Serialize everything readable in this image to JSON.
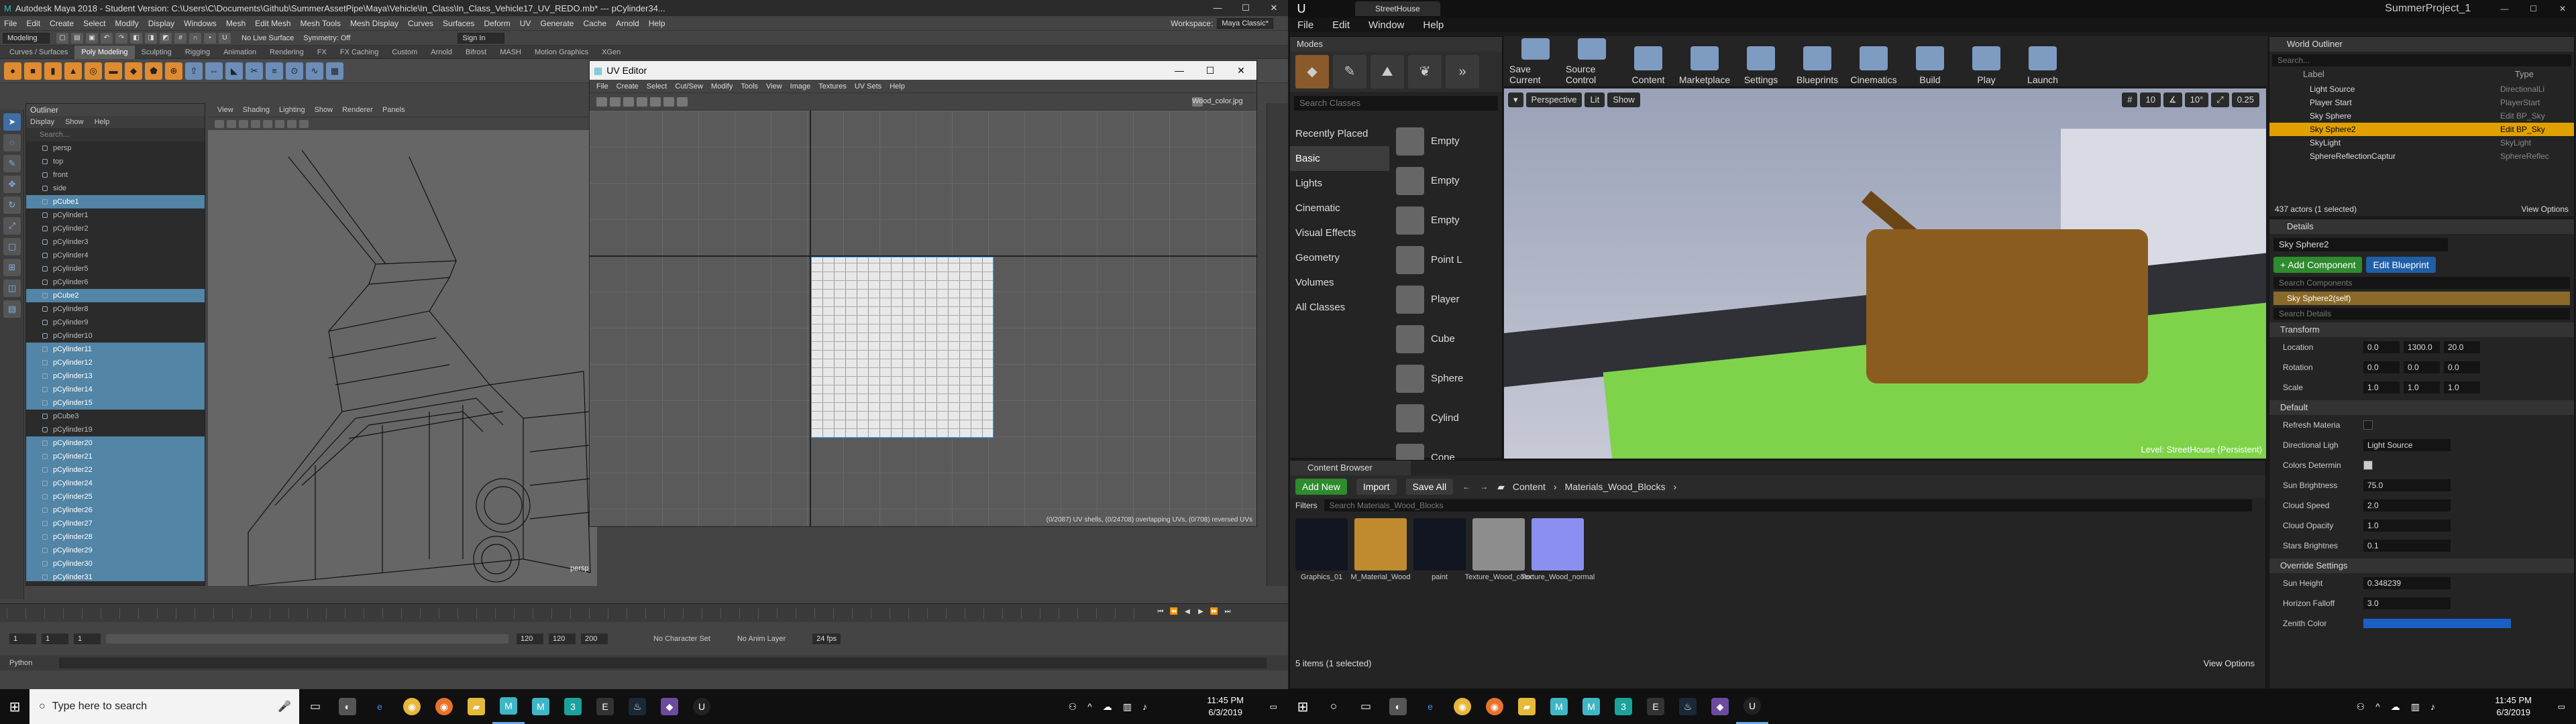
{
  "maya": {
    "title": "Autodesk Maya 2018 - Student Version: C:\\Users\\C\\Documents\\Github\\SummerAssetPipe\\Maya\\Vehicle\\In_Class\\In_Class_Vehicle17_UV_REDO.mb* --- pCylinder34...",
    "window_controls": [
      "—",
      "☐",
      "✕"
    ],
    "menus": [
      "File",
      "Edit",
      "Create",
      "Select",
      "Modify",
      "Display",
      "Windows",
      "Mesh",
      "Edit Mesh",
      "Mesh Tools",
      "Mesh Display",
      "Curves",
      "Surfaces",
      "Deform",
      "UV",
      "Generate",
      "Cache",
      "Arnold",
      "Help"
    ],
    "workspace_label": "Workspace:",
    "workspace_value": "Maya Classic*",
    "mode_value": "Modeling",
    "live_surface": "No Live Surface",
    "symmetry": "Symmetry: Off",
    "sign_in": "Sign In",
    "shelf_tabs": [
      "Curves / Surfaces",
      "Poly Modeling",
      "Sculpting",
      "Rigging",
      "Animation",
      "Rendering",
      "FX",
      "FX Caching",
      "Custom",
      "Arnold",
      "Bifrost",
      "MASH",
      "Motion Graphics",
      "XGen"
    ],
    "shelf_active": "Poly Modeling",
    "outliner": {
      "title": "Outliner",
      "menus": [
        "Display",
        "Show",
        "Help"
      ],
      "search_placeholder": "Search...",
      "items": [
        {
          "name": "persp",
          "sel": false
        },
        {
          "name": "top",
          "sel": false
        },
        {
          "name": "front",
          "sel": false
        },
        {
          "name": "side",
          "sel": false
        },
        {
          "name": "pCube1",
          "sel": true
        },
        {
          "name": "pCylinder1",
          "sel": false
        },
        {
          "name": "pCylinder2",
          "sel": false
        },
        {
          "name": "pCylinder3",
          "sel": false
        },
        {
          "name": "pCylinder4",
          "sel": false
        },
        {
          "name": "pCylinder5",
          "sel": false
        },
        {
          "name": "pCylinder6",
          "sel": false
        },
        {
          "name": "pCube2",
          "sel": true
        },
        {
          "name": "pCylinder8",
          "sel": false
        },
        {
          "name": "pCylinder9",
          "sel": false
        },
        {
          "name": "pCylinder10",
          "sel": false
        },
        {
          "name": "pCylinder11",
          "sel": true
        },
        {
          "name": "pCylinder12",
          "sel": true
        },
        {
          "name": "pCylinder13",
          "sel": true
        },
        {
          "name": "pCylinder14",
          "sel": true
        },
        {
          "name": "pCylinder15",
          "sel": true
        },
        {
          "name": "pCube3",
          "sel": false
        },
        {
          "name": "pCylinder19",
          "sel": false
        },
        {
          "name": "pCylinder20",
          "sel": true
        },
        {
          "name": "pCylinder21",
          "sel": true
        },
        {
          "name": "pCylinder22",
          "sel": true
        },
        {
          "name": "pCylinder24",
          "sel": true
        },
        {
          "name": "pCylinder25",
          "sel": true
        },
        {
          "name": "pCylinder26",
          "sel": true
        },
        {
          "name": "pCylinder27",
          "sel": true
        },
        {
          "name": "pCylinder28",
          "sel": true
        },
        {
          "name": "pCylinder29",
          "sel": true
        },
        {
          "name": "pCylinder30",
          "sel": true
        },
        {
          "name": "pCylinder31",
          "sel": true
        }
      ]
    },
    "viewport": {
      "menus": [
        "View",
        "Shading",
        "Lighting",
        "Show",
        "Renderer",
        "Panels"
      ],
      "camera_label": "persp"
    },
    "uv_editor": {
      "title": "UV Editor",
      "window_controls": [
        "—",
        "☐",
        "✕"
      ],
      "menus": [
        "File",
        "Create",
        "Select",
        "Cut/Sew",
        "Modify",
        "Tools",
        "View",
        "Image",
        "Textures",
        "UV Sets",
        "Help"
      ],
      "texture": "Wood_color.jpg",
      "status": "(0/2087) UV shells, (0/24708) overlapping UVs, (0/708) reversed UVs"
    },
    "timeline": {
      "start": "1",
      "start2": "1",
      "end": "120",
      "end2": "120",
      "end3": "200",
      "mid": "1",
      "character_set": "No Character Set",
      "anim_layer": "No Anim Layer",
      "fps": "24 fps",
      "play_controls": [
        "⏮",
        "⏪",
        "◀",
        "▶",
        "⏩",
        "⏭"
      ]
    },
    "command_label": "Python"
  },
  "unreal": {
    "tab": "StreetHouse",
    "project": "SummerProject_1",
    "window_controls": [
      "—",
      "☐",
      "✕"
    ],
    "menus": [
      "File",
      "Edit",
      "Window",
      "Help"
    ],
    "modes": {
      "tab": "Modes",
      "search_placeholder": "Search Classes",
      "categories": [
        "Recently Placed",
        "Basic",
        "Lights",
        "Cinematic",
        "Visual Effects",
        "Geometry",
        "Volumes",
        "All Classes"
      ],
      "active_category": "Basic",
      "items": [
        "Empty",
        "Empty",
        "Empty",
        "Point L",
        "Player",
        "Cube",
        "Sphere",
        "Cylind",
        "Cone"
      ]
    },
    "toolbar": [
      "Save Current",
      "Source Control",
      "Content",
      "Marketplace",
      "Settings",
      "Blueprints",
      "Cinematics",
      "Build",
      "Play",
      "Launch"
    ],
    "viewport": {
      "perspective": "Perspective",
      "lit": "Lit",
      "show": "Show",
      "grid": "10",
      "angle": "10°",
      "scale": "0.25",
      "level": "Level:  StreetHouse (Persistent)"
    },
    "content_browser": {
      "tab": "Content Browser",
      "add_new": "Add New",
      "import": "Import",
      "save_all": "Save All",
      "crumbs": [
        "Content",
        "Materials_Wood_Blocks"
      ],
      "filters": "Filters",
      "search_placeholder": "Search Materials_Wood_Blocks",
      "assets": [
        {
          "name": "Graphics_01",
          "color": "#111622"
        },
        {
          "name": "M_Material_Wood",
          "color": "#c08a2e"
        },
        {
          "name": "paint",
          "color": "#111622"
        },
        {
          "name": "Texture_Wood_color",
          "color": "#8d8d8d"
        },
        {
          "name": "Texture_Wood_normal",
          "color": "#8a8ff0"
        }
      ],
      "footer": "5 items (1 selected)",
      "view_options": "View Options"
    },
    "world_outliner": {
      "tab": "World Outliner",
      "search_placeholder": "Search...",
      "col_label": "Label",
      "col_type": "Type",
      "items": [
        {
          "label": "Light Source",
          "type": "DirectionalLi",
          "sel": false
        },
        {
          "label": "Player Start",
          "type": "PlayerStart",
          "sel": false
        },
        {
          "label": "Sky Sphere",
          "type": "Edit BP_Sky",
          "sel": false
        },
        {
          "label": "Sky Sphere2",
          "type": "Edit BP_Sky",
          "sel": true
        },
        {
          "label": "SkyLight",
          "type": "SkyLight",
          "sel": false
        },
        {
          "label": "SphereReflectionCaptur",
          "type": "SphereReflec",
          "sel": false
        }
      ],
      "count": "437 actors (1 selected)",
      "view_options": "View Options"
    },
    "details": {
      "tab": "Details",
      "name": "Sky Sphere2",
      "add_component": "+ Add Component",
      "edit_blueprint": "Edit Blueprint",
      "search_components": "Search Components",
      "self": "Sky Sphere2(self)",
      "search_details": "Search Details",
      "transform": "Transform",
      "location_label": "Location",
      "location": [
        "0.0",
        "1300.0",
        "20.0"
      ],
      "rotation_label": "Rotation",
      "rotation": [
        "0.0",
        "0.0",
        "0.0"
      ],
      "scale_label": "Scale",
      "scale": [
        "1.0",
        "1.0",
        "1.0"
      ],
      "default": "Default",
      "refresh_material": "Refresh Materia",
      "directional_light": "Directional Ligh",
      "directional_light_value": "Light Source",
      "colors_determined": "Colors Determin",
      "sun_brightness": "Sun Brightness",
      "sun_brightness_v": "75.0",
      "cloud_speed": "Cloud Speed",
      "cloud_speed_v": "2.0",
      "cloud_opacity": "Cloud Opacity",
      "cloud_opacity_v": "1.0",
      "stars_brightness": "Stars Brightnes",
      "stars_brightness_v": "0.1",
      "override": "Override Settings",
      "sun_height": "Sun Height",
      "sun_height_v": "0.348239",
      "horizon_falloff": "Horizon Falloff",
      "horizon_falloff_v": "3.0",
      "zenith_color": "Zenith Color",
      "zenith_color_hex": "#1a5fc4"
    }
  },
  "taskbar": {
    "search_placeholder": "Type here to search",
    "time": "11:45 PM",
    "date": "6/3/2019",
    "time2": "11:45 PM",
    "date2": "6/3/2019"
  }
}
